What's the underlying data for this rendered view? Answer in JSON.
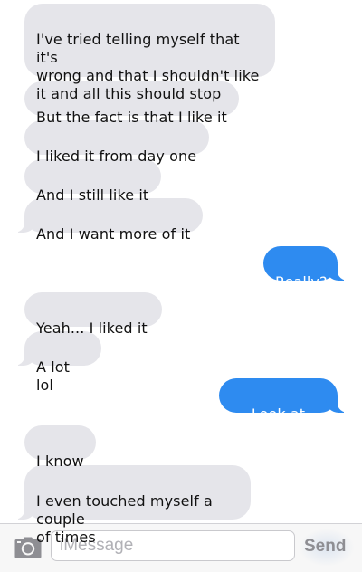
{
  "messages": [
    {
      "side": "in",
      "text": "I've tried telling myself that it's\nwrong and that I shouldn't like\nit and all this should stop",
      "tail": false
    },
    {
      "side": "in",
      "text": "But the fact is that I like it",
      "tail": false
    },
    {
      "side": "in",
      "text": "I liked it from day one",
      "tail": false
    },
    {
      "side": "in",
      "text": "And I still like it",
      "tail": false
    },
    {
      "side": "in",
      "text": "And I want more of it",
      "tail": true
    },
    {
      "side": "out",
      "text": "Really?",
      "tail": true
    },
    {
      "side": "in",
      "text": "Yeah... I liked it",
      "tail": false
    },
    {
      "side": "in",
      "text": "A lot lol",
      "tail": true
    },
    {
      "side": "out",
      "text": "Look at you!!",
      "tail": true
    },
    {
      "side": "in",
      "text": "I know",
      "tail": false
    },
    {
      "side": "in",
      "text": "I even touched myself a couple\nof times",
      "tail": true
    }
  ],
  "composer": {
    "placeholder": "iMessage",
    "send_label": "Send",
    "camera_icon": "camera-icon"
  },
  "colors": {
    "incoming_bubble": "#e5e5ea",
    "outgoing_bubble": "#2e8bf0",
    "send_label": "#8e8e93"
  }
}
